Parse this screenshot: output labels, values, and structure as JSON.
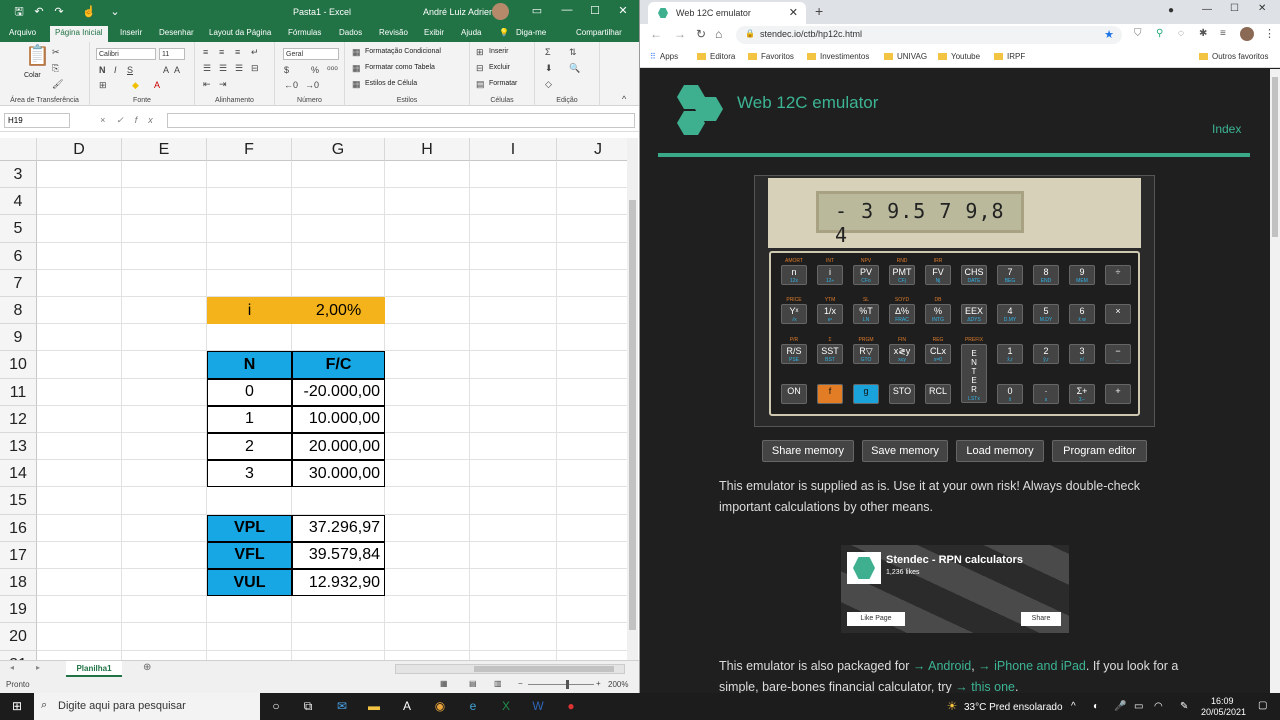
{
  "excel": {
    "title": "Pasta1  -  Excel",
    "user": "André Luiz Adrien",
    "tabs": [
      "Arquivo",
      "Página Inicial",
      "Inserir",
      "Desenhar",
      "Layout da Página",
      "Fórmulas",
      "Dados",
      "Revisão",
      "Exibir",
      "Ajuda",
      "Diga-me",
      "Compartilhar"
    ],
    "ribbon": {
      "paste": "Colar",
      "font": "Calibri",
      "font_size": "11",
      "number_format": "Geral",
      "cond_format": "Formatação Condicional",
      "format_table": "Formatar como Tabela",
      "cell_styles": "Estilos de Célula",
      "insert": "Inserir",
      "delete": "Excluir",
      "format": "Formatar",
      "groups": [
        "Área de Transferência",
        "Fonte",
        "Alinhamento",
        "Número",
        "Estilos",
        "Células",
        "Edição"
      ]
    },
    "namebox": "H19",
    "columns": [
      "D",
      "E",
      "F",
      "G",
      "H",
      "I",
      "J"
    ],
    "rows": [
      "3",
      "4",
      "5",
      "6",
      "7",
      "8",
      "9",
      "10",
      "11",
      "12",
      "13",
      "14",
      "15",
      "16",
      "17",
      "18",
      "19",
      "20",
      "21"
    ],
    "rate_label": "i",
    "rate_value": "2,00%",
    "table_headers": [
      "N",
      "F/C"
    ],
    "table_rows": [
      [
        "0",
        "-20.000,00"
      ],
      [
        "1",
        "10.000,00"
      ],
      [
        "2",
        "20.000,00"
      ],
      [
        "3",
        "30.000,00"
      ]
    ],
    "results": [
      [
        "VPL",
        "37.296,97"
      ],
      [
        "VFL",
        "39.579,84"
      ],
      [
        "VUL",
        "12.932,90"
      ]
    ],
    "sheet": "Planilha1",
    "status": "Pronto",
    "zoom": "200%",
    "colors": {
      "green": "#217346",
      "orange": "#f5b31b",
      "blue": "#17a7e4"
    }
  },
  "browser": {
    "tab_title": "Web 12C emulator",
    "url": "stendec.io/ctb/hp12c.html",
    "bookmarks": [
      "Apps",
      "Editora",
      "Favoritos",
      "Investimentos",
      "UNIVAG",
      "Youtube",
      "IRPF",
      "Outros favoritos"
    ],
    "site_title": "Web 12C emulator",
    "index": "Index",
    "display": "- 3 9.5 7 9,8 4",
    "buttons": [
      "Share memory",
      "Save memory",
      "Load memory",
      "Program editor"
    ],
    "p1": "This emulator is supplied as is. Use it at your own risk! Always double-check important calculations by other means.",
    "fb_name": "Stendec - RPN calculators",
    "fb_likes": "1,236 likes",
    "fb_like": "Like Page",
    "fb_share": "Share",
    "p2_a": "This emulator is also packaged for ",
    "p2_android": "→ Android",
    "p2_ios": "→ iPhone and iPad",
    "p2_b": ". If you look for a simple, bare-bones financial calculator, try ",
    "p2_this": "→ this one",
    "p2_c": ".",
    "accent": "#3cb494"
  },
  "calc_keys": [
    [
      {
        "k": "n",
        "s": "12x",
        "f": "AMORT"
      },
      {
        "k": "i",
        "s": "12÷",
        "f": "INT"
      },
      {
        "k": "PV",
        "s": "CFo",
        "f": "NPV"
      },
      {
        "k": "PMT",
        "s": "CFj",
        "f": "RND"
      },
      {
        "k": "FV",
        "s": "Nj",
        "f": "IRR"
      },
      {
        "k": "CHS",
        "s": "DATE",
        "f": ""
      },
      {
        "k": "7",
        "s": "BEG",
        "f": ""
      },
      {
        "k": "8",
        "s": "END",
        "f": ""
      },
      {
        "k": "9",
        "s": "MEM",
        "f": ""
      },
      {
        "k": "÷",
        "s": "",
        "f": ""
      }
    ],
    [
      {
        "k": "Yˣ",
        "s": "√x",
        "f": "PRICE"
      },
      {
        "k": "1/x",
        "s": "eˣ",
        "f": "YTM"
      },
      {
        "k": "%T",
        "s": "LN",
        "f": "SL"
      },
      {
        "k": "Δ%",
        "s": "FRAC",
        "f": "SOYD"
      },
      {
        "k": "%",
        "s": "INTG",
        "f": "DB"
      },
      {
        "k": "EEX",
        "s": "ΔDYS",
        "f": ""
      },
      {
        "k": "4",
        "s": "D.MY",
        "f": ""
      },
      {
        "k": "5",
        "s": "M.DY",
        "f": ""
      },
      {
        "k": "6",
        "s": "x̄ w",
        "f": ""
      },
      {
        "k": "×",
        "s": "",
        "f": ""
      }
    ],
    [
      {
        "k": "R/S",
        "s": "PSE",
        "f": "P/R"
      },
      {
        "k": "SST",
        "s": "BST",
        "f": "Σ"
      },
      {
        "k": "R▽",
        "s": "GTO",
        "f": "PRGM"
      },
      {
        "k": "x≷y",
        "s": "x≤y",
        "f": "FIN"
      },
      {
        "k": "CLx",
        "s": "x=0",
        "f": "REG"
      },
      {
        "k": "",
        "s": "",
        "f": "PREFIX"
      },
      {
        "k": "1",
        "s": "x̂,r",
        "f": ""
      },
      {
        "k": "2",
        "s": "ŷ,r",
        "f": ""
      },
      {
        "k": "3",
        "s": "n!",
        "f": ""
      },
      {
        "k": "−",
        "s": "←",
        "f": ""
      }
    ],
    [
      {
        "k": "ON",
        "s": "",
        "f": ""
      },
      {
        "k": "f",
        "s": "",
        "f": ""
      },
      {
        "k": "g",
        "s": "",
        "f": ""
      },
      {
        "k": "STO",
        "s": "",
        "f": ""
      },
      {
        "k": "RCL",
        "s": "",
        "f": ""
      },
      {
        "k": "",
        "s": "",
        "f": ""
      },
      {
        "k": "0",
        "s": "x̄",
        "f": ""
      },
      {
        "k": "·",
        "s": "s",
        "f": ""
      },
      {
        "k": "Σ+",
        "s": "Σ−",
        "f": ""
      },
      {
        "k": "+",
        "s": "",
        "f": ""
      }
    ]
  ],
  "enter": {
    "label": "ENTER",
    "sub": "LSTx"
  },
  "taskbar": {
    "search": "Digite aqui para pesquisar",
    "weather": "33°C  Pred ensolarado",
    "time": "16:09",
    "date": "20/05/2021"
  }
}
